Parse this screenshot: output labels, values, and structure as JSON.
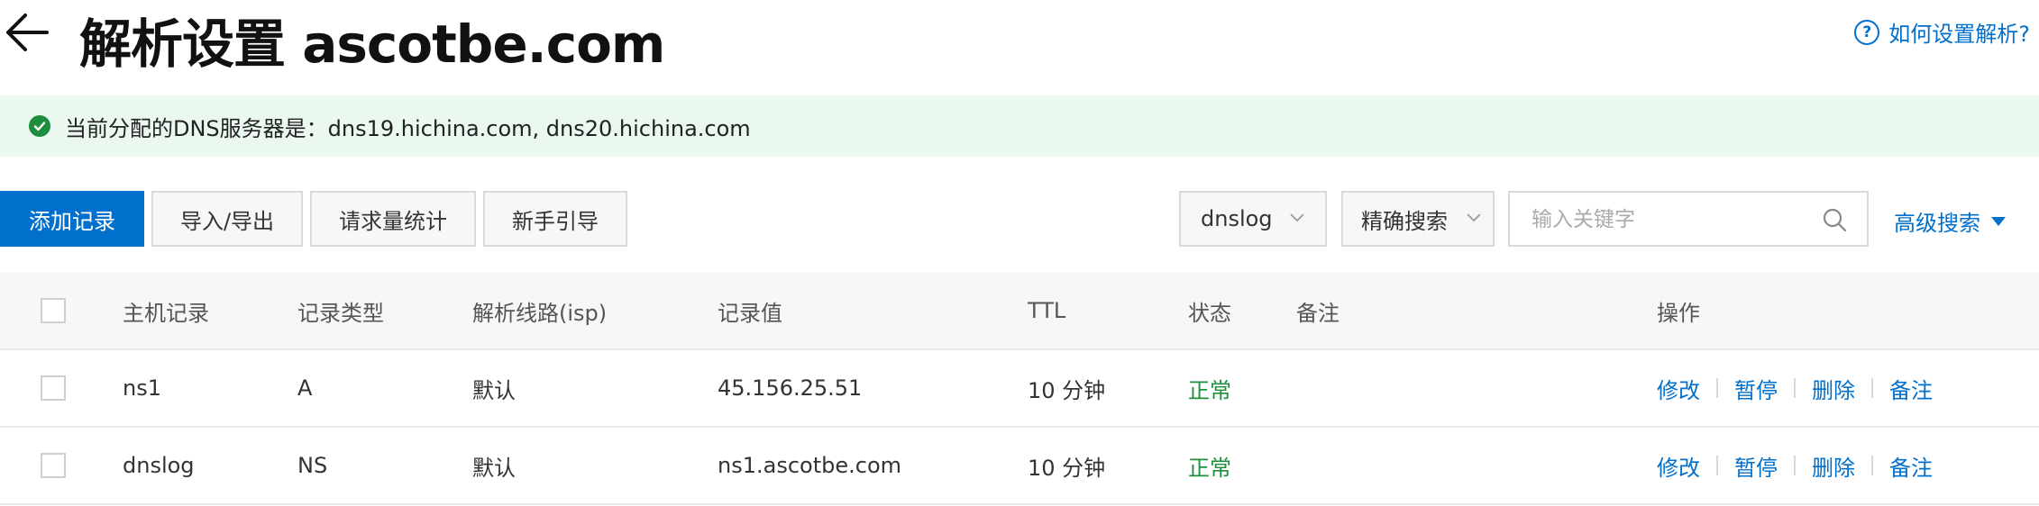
{
  "header": {
    "title": "解析设置 ascotbe.com",
    "help_link": "如何设置解析?",
    "help_icon_glyph": "?"
  },
  "notice": {
    "text": "当前分配的DNS服务器是：dns19.hichina.com, dns20.hichina.com",
    "icon": "check-circle-icon",
    "color": "#1e8e3e"
  },
  "toolbar": {
    "add_record": "添加记录",
    "import_export": "导入/导出",
    "request_stats": "请求量统计",
    "beginner_guide": "新手引导",
    "subdomain_select": "dnslog",
    "search_mode_select": "精确搜索",
    "search_placeholder": "输入关键字",
    "advanced_search": "高级搜索"
  },
  "table": {
    "columns": [
      "主机记录",
      "记录类型",
      "解析线路(isp)",
      "记录值",
      "TTL",
      "状态",
      "备注",
      "操作"
    ],
    "rows": [
      {
        "host": "ns1",
        "type": "A",
        "line": "默认",
        "value": "45.156.25.51",
        "ttl": "10 分钟",
        "status": "正常",
        "remark": ""
      },
      {
        "host": "dnslog",
        "type": "NS",
        "line": "默认",
        "value": "ns1.ascotbe.com",
        "ttl": "10 分钟",
        "status": "正常",
        "remark": ""
      }
    ],
    "actions": [
      "修改",
      "暂停",
      "删除",
      "备注"
    ]
  },
  "colors": {
    "primary": "#0070cc",
    "success": "#1e8e3e",
    "notice_bg": "#ebf8f0"
  }
}
